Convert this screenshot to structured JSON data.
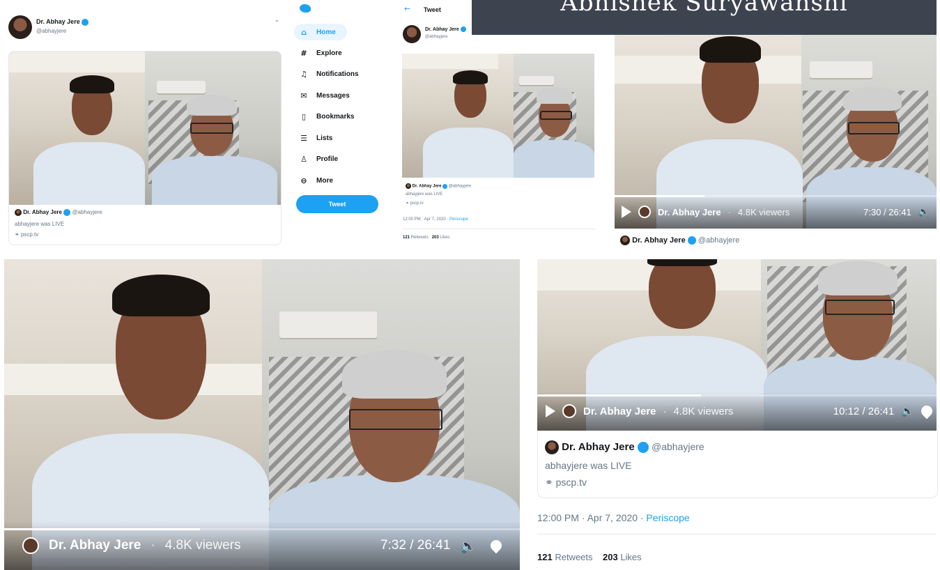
{
  "banner": {
    "title": "Abhishek Suryawanshi"
  },
  "user": {
    "name": "Dr. Abhay Jere",
    "handle": "@abhayjere",
    "status": "abhayjere was LIVE",
    "link": "pscp.tv"
  },
  "sidebar": {
    "items": [
      {
        "label": "Home",
        "icon": "home-icon"
      },
      {
        "label": "Explore",
        "icon": "hashtag-icon"
      },
      {
        "label": "Notifications",
        "icon": "bell-icon"
      },
      {
        "label": "Messages",
        "icon": "mail-icon"
      },
      {
        "label": "Bookmarks",
        "icon": "bookmark-icon"
      },
      {
        "label": "Lists",
        "icon": "list-icon"
      },
      {
        "label": "Profile",
        "icon": "person-icon"
      },
      {
        "label": "More",
        "icon": "more-icon"
      }
    ],
    "tweet_button": "Tweet"
  },
  "tweet_page": {
    "header": "Tweet",
    "timestamp": "12:00 PM · Apr 7, 2020 · ",
    "source": "Periscope",
    "retweets": "121",
    "retweets_label": "Retweets",
    "likes": "203",
    "likes_label": "Likes"
  },
  "videos": {
    "v1": {
      "name": "Dr. Abhay Jere",
      "viewers": "4.8K viewers",
      "time": "7:30 / 26:41",
      "progress": 0.28
    },
    "v2": {
      "name": "Dr. Abhay Jere",
      "viewers": "4.8K viewers",
      "time": "7:32 / 26:41",
      "progress": 0.38
    },
    "v3": {
      "name": "Dr. Abhay Jere",
      "viewers": "4.8K viewers",
      "time": "10:12 / 26:41",
      "progress": 0.41
    }
  },
  "bottom_card": {
    "name": "Dr. Abhay Jere",
    "handle": "@abhayjere",
    "status": "abhayjere was LIVE",
    "link": "pscp.tv",
    "timestamp": "12:00 PM · Apr 7, 2020 · ",
    "source": "Periscope",
    "retweets": "121",
    "retweets_label": "Retweets",
    "likes": "203",
    "likes_label": "Likes"
  },
  "colors": {
    "twitter_blue": "#1da1f2",
    "banner_bg": "#3d4450"
  }
}
